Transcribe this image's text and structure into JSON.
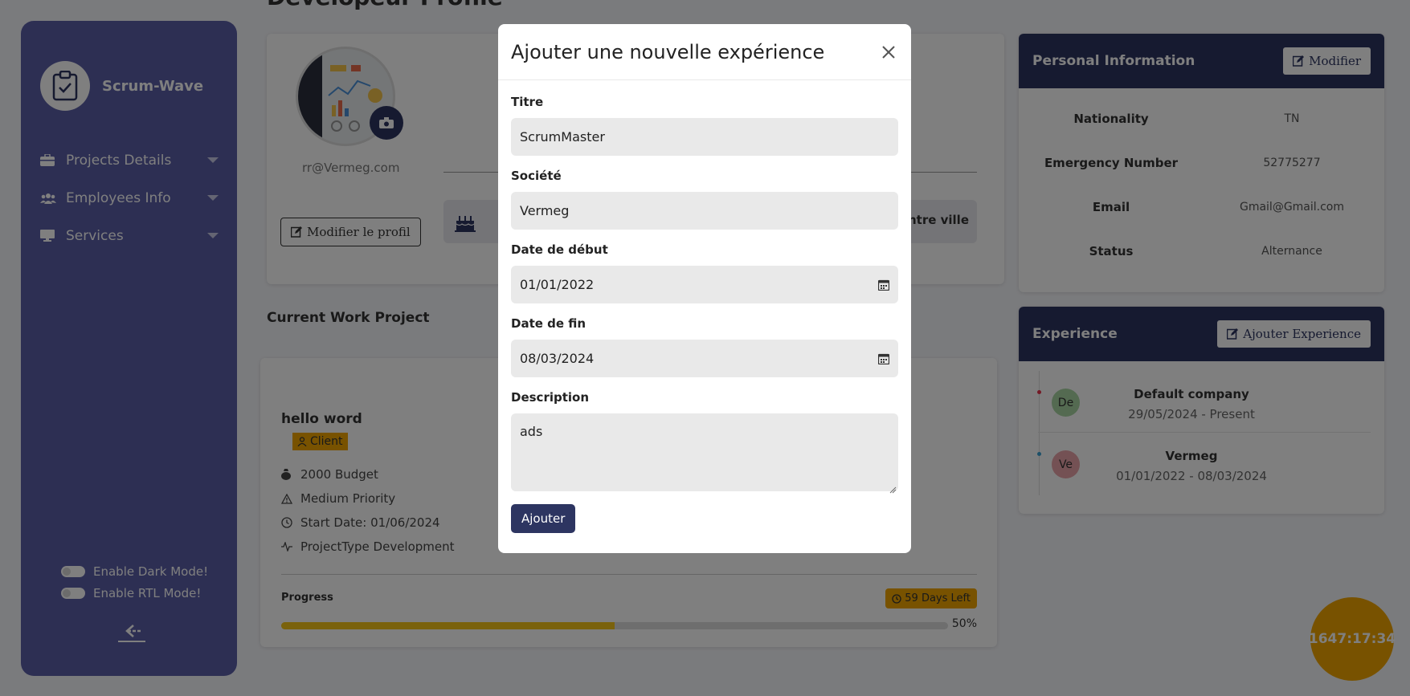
{
  "sidebar": {
    "brand": "Scrum-Wave",
    "brand_icon": "clipboard-check-icon",
    "items": [
      {
        "label": "Projects Details",
        "icon": "briefcase-icon"
      },
      {
        "label": "Employees Info",
        "icon": "users-icon"
      },
      {
        "label": "Services",
        "icon": "monitor-icon"
      }
    ],
    "dark_mode_label": "Enable Dark Mode!",
    "rtl_mode_label": "Enable RTL Mode!"
  },
  "page": {
    "title": "Developeur Profile"
  },
  "profile": {
    "email": "rr@Vermeg.com",
    "edit_label": "Modifier le profil",
    "location_text": "entre ville"
  },
  "project": {
    "section_title": "Current Work Project",
    "name": "hello word",
    "client_label": "Client",
    "budget": "2000 Budget",
    "priority": "Medium Priority",
    "start_date": "Start Date: 01/06/2024",
    "project_type": "ProjectType Development",
    "progress_label": "Progress",
    "days_left": "59 Days Left",
    "progress_percent": 50,
    "progress_text": "50%"
  },
  "personal_info": {
    "title": "Personal Information",
    "edit_label": "Modifier",
    "rows": [
      {
        "key": "Nationality",
        "value": "TN"
      },
      {
        "key": "Emergency Number",
        "value": "52775277"
      },
      {
        "key": "Email",
        "value": "Gmail@Gmail.com"
      },
      {
        "key": "Status",
        "value": "Alternance"
      }
    ]
  },
  "experience": {
    "title": "Experience",
    "add_label": "Ajouter Experience",
    "items": [
      {
        "initials": "De",
        "company": "Default company",
        "dates": "29/05/2024 - Present",
        "avatar_color": "#a8d5a2",
        "dot_color": "#e8334a"
      },
      {
        "initials": "Ve",
        "company": "Vermeg",
        "dates": "01/01/2022 - 08/03/2024",
        "avatar_color": "#e8a3a8",
        "dot_color": "#3aa0d0"
      }
    ]
  },
  "timer": "1647:17:34",
  "modal": {
    "title": "Ajouter une nouvelle expérience",
    "fields": {
      "titre_label": "Titre",
      "titre_value": "ScrumMaster",
      "societe_label": "Société",
      "societe_value": "Vermeg",
      "debut_label": "Date de début",
      "debut_value": "01/01/2022",
      "fin_label": "Date de fin",
      "fin_value": "08/03/2024",
      "description_label": "Description",
      "description_value": "ads"
    },
    "submit_label": "Ajouter"
  },
  "colors": {
    "sidebar": "#5b5ea6",
    "header_dark": "#2d3561",
    "accent": "#f0a500",
    "progress": "#f5c518"
  }
}
